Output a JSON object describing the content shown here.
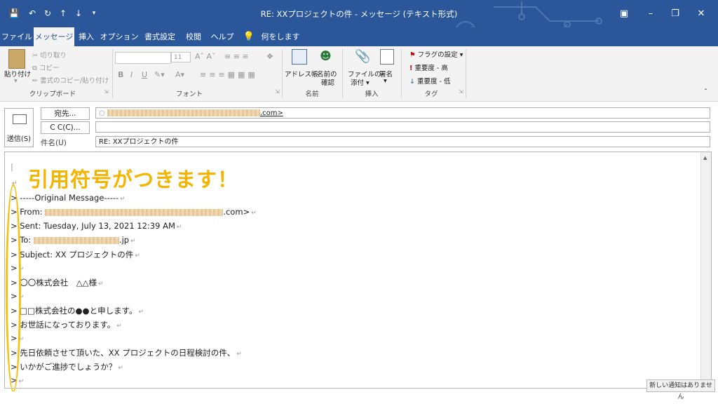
{
  "window": {
    "title": "RE: XXプロジェクトの件  -  メッセージ (テキスト形式)"
  },
  "tabs": [
    "ファイル",
    "メッセージ",
    "挿入",
    "オプション",
    "書式設定",
    "校閲",
    "ヘルプ",
    "何をしますか"
  ],
  "active_tab": "メッセージ",
  "ribbon": {
    "clipboard": {
      "paste": "貼り付け",
      "cut": "切り取り",
      "copy": "コピー",
      "format_painter": "書式のコピー/貼り付け",
      "label": "クリップボード"
    },
    "font": {
      "label": "フォント",
      "size": "11"
    },
    "names": {
      "address_book": "アドレス帳",
      "check_names_1": "名前の",
      "check_names_2": "確認",
      "label": "名前"
    },
    "include": {
      "attach_1": "ファイルの",
      "attach_2": "添付",
      "signature": "署名",
      "label": "挿入"
    },
    "tags": {
      "flag": "フラグの設定",
      "high": "重要度 - 高",
      "low": "重要度 - 低",
      "label": "タグ"
    }
  },
  "compose": {
    "send_label": "送信(S)",
    "to_button": "宛先...",
    "cc_button": "C C(C)...",
    "subject_label": "件名(U)",
    "to_suffix": ".com>",
    "subject_value": "RE: XXプロジェクトの件"
  },
  "body": {
    "lines": [
      "> -----Original Message-----",
      "> From: ",
      "> Sent: Tuesday, July 13, 2021 12:39 AM",
      "> To: ",
      "> Subject: XX プロジェクトの件",
      ">",
      "> 〇〇株式会社　△△様",
      ">",
      "> □□株式会社の●●と申します。",
      "> お世話になっております。",
      ">",
      "> 先日依頼させて頂いた、XX プロジェクトの日程検討の件、",
      "> いかがご進捗でしょうか？",
      ">"
    ],
    "from_suffix": ".com>",
    "to_suffix": ".jp"
  },
  "annotation": "引用符号がつきます！",
  "notification": "新しい通知はありません",
  "colors": {
    "titlebar": "#2b579a",
    "annotation": "#f4b400"
  }
}
